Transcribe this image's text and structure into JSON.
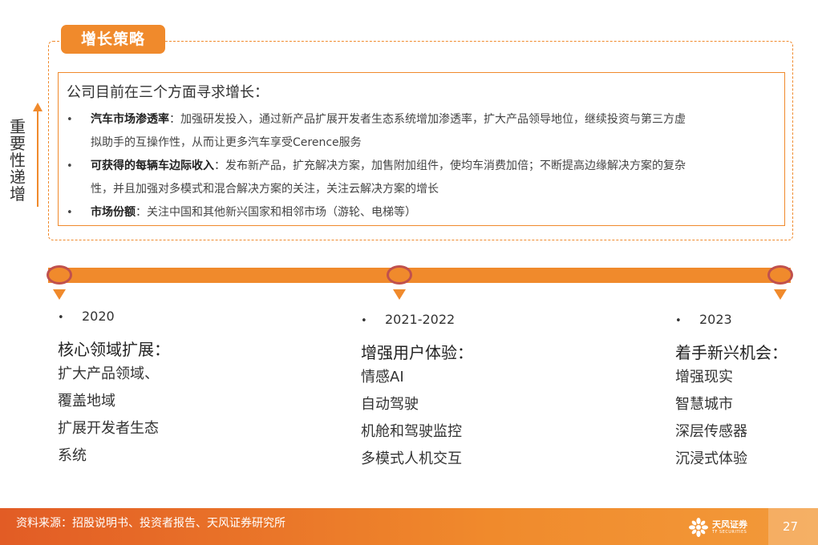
{
  "strategy": {
    "tab_label": "增长策略",
    "intro": "公司目前在三个方面寻求增长：",
    "bullets": [
      {
        "bold": "汽车市场渗透率",
        "text": "：加强研发投入，通过新产品扩展开发者生态系统增加渗透率，扩大产品领导地位，继续投资与第三方虚",
        "text2": "拟助手的互操作性，从而让更多汽车享受Cerence服务"
      },
      {
        "bold": "可获得的每辆车边际收入",
        "text": "：发布新产品，扩充解决方案，加售附加组件，使均车消费加倍；不断提高边缘解决方案的复杂",
        "text2": "性，并且加强对多模式和混合解决方案的关注，关注云解决方案的增长"
      },
      {
        "bold": "市场份额",
        "text": "：关注中国和其他新兴国家和相邻市场（游轮、电梯等）",
        "text2": ""
      }
    ],
    "bullet_char": "•"
  },
  "side_label": [
    "重",
    "要",
    "性",
    "递",
    "增"
  ],
  "timeline": [
    {
      "year": "2020",
      "title": "核心领域扩展：",
      "items": [
        "扩大产品领域、",
        "覆盖地域",
        "扩展开发者生态",
        "系统"
      ]
    },
    {
      "year": "2021-2022",
      "title": "增强用户体验：",
      "items": [
        "情感AI",
        "自动驾驶",
        "机舱和驾驶监控",
        "多模式人机交互"
      ]
    },
    {
      "year": "2023",
      "title": "着手新兴机会：",
      "items": [
        "增强现实",
        "智慧城市",
        "深层传感器",
        "沉浸式体验"
      ]
    }
  ],
  "footer": {
    "source": "资料来源：招股说明书、投资者报告、天风证券研究所",
    "logo_text": "天风证券",
    "logo_sub": "TF SECURITIES",
    "page_number": "27"
  },
  "colors": {
    "accent": "#f08a2c",
    "node_border": "#c0504d",
    "footer_start": "#e25c25"
  }
}
